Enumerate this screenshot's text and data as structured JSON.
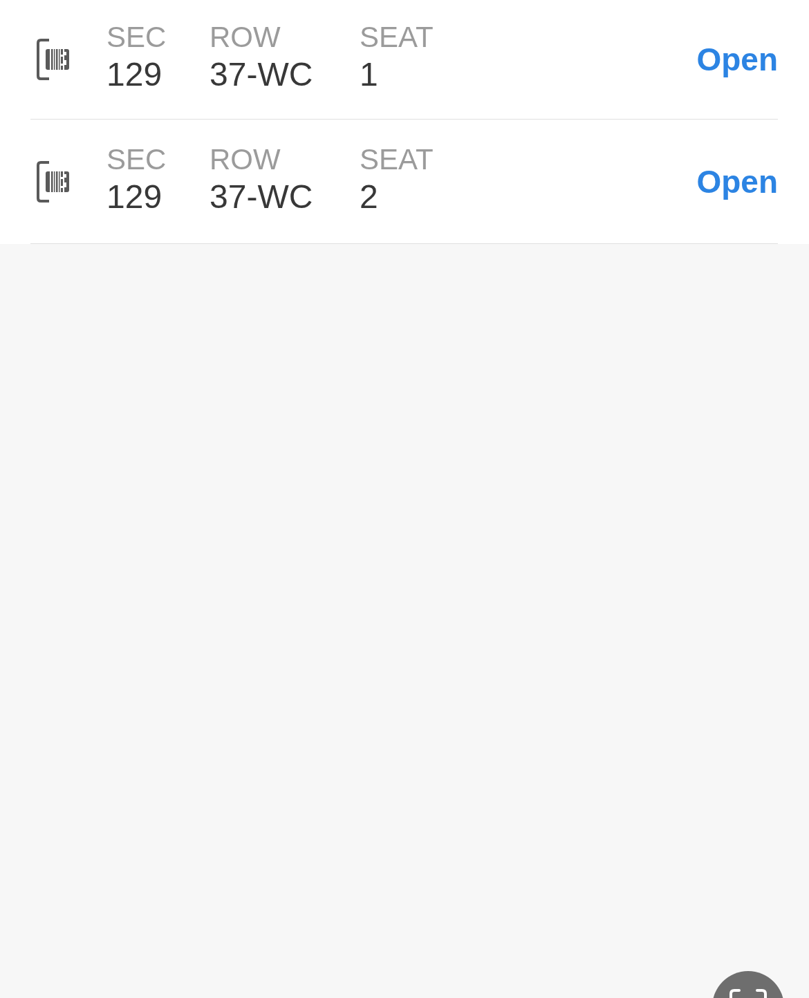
{
  "tickets": [
    {
      "section_label": "SEC",
      "section": "129",
      "row_label": "ROW",
      "row": "37-WC",
      "seat_label": "SEAT",
      "seat": "1",
      "action": "Open"
    },
    {
      "section_label": "SEC",
      "section": "129",
      "row_label": "ROW",
      "row": "37-WC",
      "seat_label": "SEAT",
      "seat": "2",
      "action": "Open"
    }
  ]
}
